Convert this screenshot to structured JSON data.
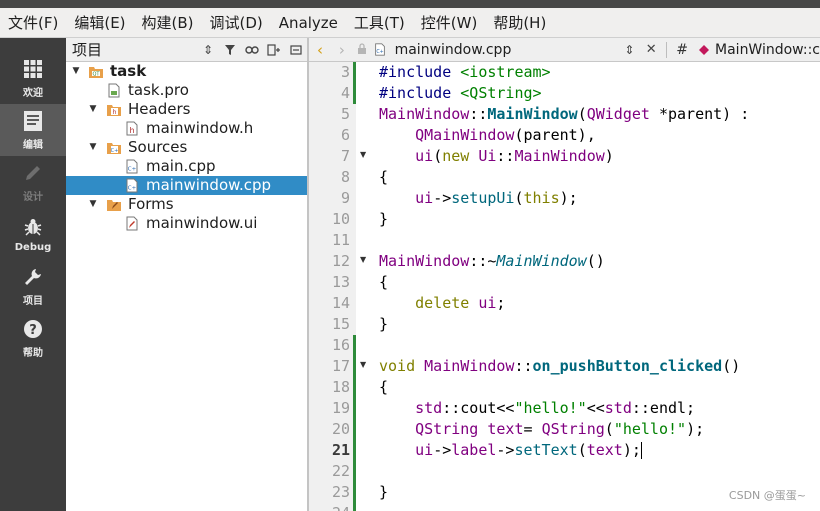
{
  "menubar": {
    "items": [
      {
        "label": "文件(F)"
      },
      {
        "label": "编辑(E)"
      },
      {
        "label": "构建(B)"
      },
      {
        "label": "调试(D)"
      },
      {
        "label": "Analyze"
      },
      {
        "label": "工具(T)"
      },
      {
        "label": "控件(W)"
      },
      {
        "label": "帮助(H)"
      }
    ]
  },
  "modebar": {
    "items": [
      {
        "label": "欢迎",
        "icon": "grid-icon"
      },
      {
        "label": "编辑",
        "icon": "document-icon",
        "active": true
      },
      {
        "label": "设计",
        "icon": "pencil-icon",
        "disabled": true
      },
      {
        "label": "Debug",
        "icon": "bug-icon"
      },
      {
        "label": "项目",
        "icon": "wrench-icon"
      },
      {
        "label": "帮助",
        "icon": "question-icon"
      }
    ]
  },
  "project_panel": {
    "title": "项目",
    "tree": [
      {
        "label": "task",
        "level": 0,
        "icon": "project-icon",
        "expanded": true
      },
      {
        "label": "task.pro",
        "level": 1,
        "icon": "pro-file-icon"
      },
      {
        "label": "Headers",
        "level": 1,
        "icon": "header-folder-icon",
        "expanded": true
      },
      {
        "label": "mainwindow.h",
        "level": 2,
        "icon": "header-file-icon"
      },
      {
        "label": "Sources",
        "level": 1,
        "icon": "source-folder-icon",
        "expanded": true
      },
      {
        "label": "main.cpp",
        "level": 2,
        "icon": "cpp-file-icon"
      },
      {
        "label": "mainwindow.cpp",
        "level": 2,
        "icon": "cpp-file-icon",
        "selected": true
      },
      {
        "label": "Forms",
        "level": 1,
        "icon": "forms-folder-icon",
        "expanded": true
      },
      {
        "label": "mainwindow.ui",
        "level": 2,
        "icon": "ui-file-icon"
      }
    ]
  },
  "editor": {
    "file_tab": "mainwindow.cpp",
    "symbol": "MainWindow::c",
    "symbol_hash": "#",
    "current_line": 21,
    "lines": [
      {
        "n": 3,
        "text": "#include <iostream>"
      },
      {
        "n": 4,
        "text": "#include <QString>"
      },
      {
        "n": 5,
        "text": "MainWindow::MainWindow(QWidget *parent) :"
      },
      {
        "n": 6,
        "text": "    QMainWindow(parent),"
      },
      {
        "n": 7,
        "text": "    ui(new Ui::MainWindow)"
      },
      {
        "n": 8,
        "text": "{"
      },
      {
        "n": 9,
        "text": "    ui->setupUi(this);"
      },
      {
        "n": 10,
        "text": "}"
      },
      {
        "n": 11,
        "text": ""
      },
      {
        "n": 12,
        "text": "MainWindow::~MainWindow()"
      },
      {
        "n": 13,
        "text": "{"
      },
      {
        "n": 14,
        "text": "    delete ui;"
      },
      {
        "n": 15,
        "text": "}"
      },
      {
        "n": 16,
        "text": ""
      },
      {
        "n": 17,
        "text": "void MainWindow::on_pushButton_clicked()"
      },
      {
        "n": 18,
        "text": "{"
      },
      {
        "n": 19,
        "text": "    std::cout<<\"hello!\"<<std::endl;"
      },
      {
        "n": 20,
        "text": "    QString text= QString(\"hello!\");"
      },
      {
        "n": 21,
        "text": "    ui->label->setText(text);"
      },
      {
        "n": 22,
        "text": ""
      },
      {
        "n": 23,
        "text": "}"
      },
      {
        "n": 24,
        "text": ""
      }
    ]
  },
  "watermark": "CSDN @蛋蛋~",
  "colors": {
    "selection": "#308cc6",
    "modebar": "#3d3d3d",
    "modebar_active": "#5a5a5a",
    "modified_marker": "#2e8b3a"
  }
}
